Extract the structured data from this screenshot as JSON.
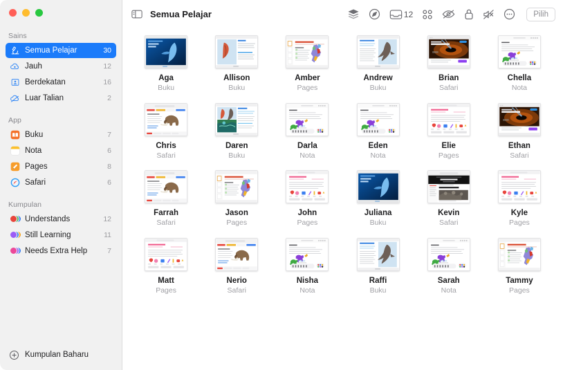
{
  "window": {
    "controls": [
      "close",
      "minimize",
      "maximize"
    ]
  },
  "sidebar": {
    "sections": [
      {
        "title": "Sains",
        "items": [
          {
            "label": "Semua Pelajar",
            "count": "30",
            "icon": "microscope-icon",
            "selected": true
          },
          {
            "label": "Jauh",
            "count": "12",
            "icon": "remote-cloud-icon",
            "selected": false
          },
          {
            "label": "Berdekatan",
            "count": "16",
            "icon": "nearby-person-icon",
            "selected": false
          },
          {
            "label": "Luar Talian",
            "count": "2",
            "icon": "offline-cloud-icon",
            "selected": false
          }
        ]
      },
      {
        "title": "App",
        "items": [
          {
            "label": "Buku",
            "count": "7",
            "icon": "books-app-icon",
            "selected": false
          },
          {
            "label": "Nota",
            "count": "6",
            "icon": "notes-app-icon",
            "selected": false
          },
          {
            "label": "Pages",
            "count": "8",
            "icon": "pages-app-icon",
            "selected": false
          },
          {
            "label": "Safari",
            "count": "6",
            "icon": "safari-app-icon",
            "selected": false
          }
        ]
      },
      {
        "title": "Kumpulan",
        "items": [
          {
            "label": "Understands",
            "count": "12",
            "icon": "group-circles-icon",
            "selected": false,
            "colors": [
              "#e8453c",
              "#4ab55f",
              "#3b7ff0"
            ]
          },
          {
            "label": "Still Learning",
            "count": "11",
            "icon": "group-circles-icon",
            "selected": false,
            "colors": [
              "#9b5cf6",
              "#3b7ff0",
              "#f5a623"
            ]
          },
          {
            "label": "Needs Extra Help",
            "count": "7",
            "icon": "group-circles-icon",
            "selected": false,
            "colors": [
              "#ec4899",
              "#9b5cf6",
              "#3b7ff0"
            ]
          }
        ]
      }
    ],
    "footer": {
      "label": "Kumpulan Baharu",
      "icon": "plus-circle-icon"
    }
  },
  "toolbar": {
    "sidebar_toggle_icon": "sidebar-toggle-icon",
    "title": "Semua Pelajar",
    "actions": [
      {
        "name": "layers-icon",
        "label": ""
      },
      {
        "name": "navigate-icon",
        "label": ""
      },
      {
        "name": "inbox-icon",
        "label": "12"
      },
      {
        "name": "apps-grid-icon",
        "label": ""
      },
      {
        "name": "hide-screen-icon",
        "label": ""
      },
      {
        "name": "lock-icon",
        "label": ""
      },
      {
        "name": "mute-icon",
        "label": ""
      },
      {
        "name": "more-icon",
        "label": ""
      }
    ],
    "select_button": "Pilih"
  },
  "grid": {
    "students": [
      {
        "name": "Aga",
        "app": "Buku",
        "thumb": "book-whale-dark"
      },
      {
        "name": "Allison",
        "app": "Buku",
        "thumb": "book-bird-sketch"
      },
      {
        "name": "Amber",
        "app": "Pages",
        "thumb": "pages-italy-map"
      },
      {
        "name": "Andrew",
        "app": "Buku",
        "thumb": "book-bird-text"
      },
      {
        "name": "Brian",
        "app": "Safari",
        "thumb": "safari-blackhole"
      },
      {
        "name": "Chella",
        "app": "Nota",
        "thumb": "notes-horse-sketch"
      },
      {
        "name": "Chris",
        "app": "Safari",
        "thumb": "safari-mammoth"
      },
      {
        "name": "Daren",
        "app": "Buku",
        "thumb": "book-collage"
      },
      {
        "name": "Darla",
        "app": "Nota",
        "thumb": "notes-horse-sketch"
      },
      {
        "name": "Eden",
        "app": "Nota",
        "thumb": "notes-horse-sketch"
      },
      {
        "name": "Elie",
        "app": "Pages",
        "thumb": "pages-pink-report"
      },
      {
        "name": "Ethan",
        "app": "Safari",
        "thumb": "safari-blackhole"
      },
      {
        "name": "Farrah",
        "app": "Safari",
        "thumb": "safari-mammoth"
      },
      {
        "name": "Jason",
        "app": "Pages",
        "thumb": "pages-italy-map"
      },
      {
        "name": "John",
        "app": "Pages",
        "thumb": "pages-pink-report"
      },
      {
        "name": "Juliana",
        "app": "Buku",
        "thumb": "book-whale-dark"
      },
      {
        "name": "Kevin",
        "app": "Safari",
        "thumb": "safari-article-dark"
      },
      {
        "name": "Kyle",
        "app": "Pages",
        "thumb": "pages-pink-report"
      },
      {
        "name": "Matt",
        "app": "Pages",
        "thumb": "pages-pink-report"
      },
      {
        "name": "Nerio",
        "app": "Safari",
        "thumb": "safari-mammoth"
      },
      {
        "name": "Nisha",
        "app": "Nota",
        "thumb": "notes-horse-sketch"
      },
      {
        "name": "Raffi",
        "app": "Buku",
        "thumb": "book-bird-text"
      },
      {
        "name": "Sarah",
        "app": "Nota",
        "thumb": "notes-horse-sketch"
      },
      {
        "name": "Tammy",
        "app": "Pages",
        "thumb": "pages-italy-map"
      }
    ]
  },
  "colors": {
    "accent": "#1b7bfa",
    "sidebar_bg": "#f1f1f1",
    "text": "#1d1d1f",
    "muted": "#a0a0a5"
  }
}
